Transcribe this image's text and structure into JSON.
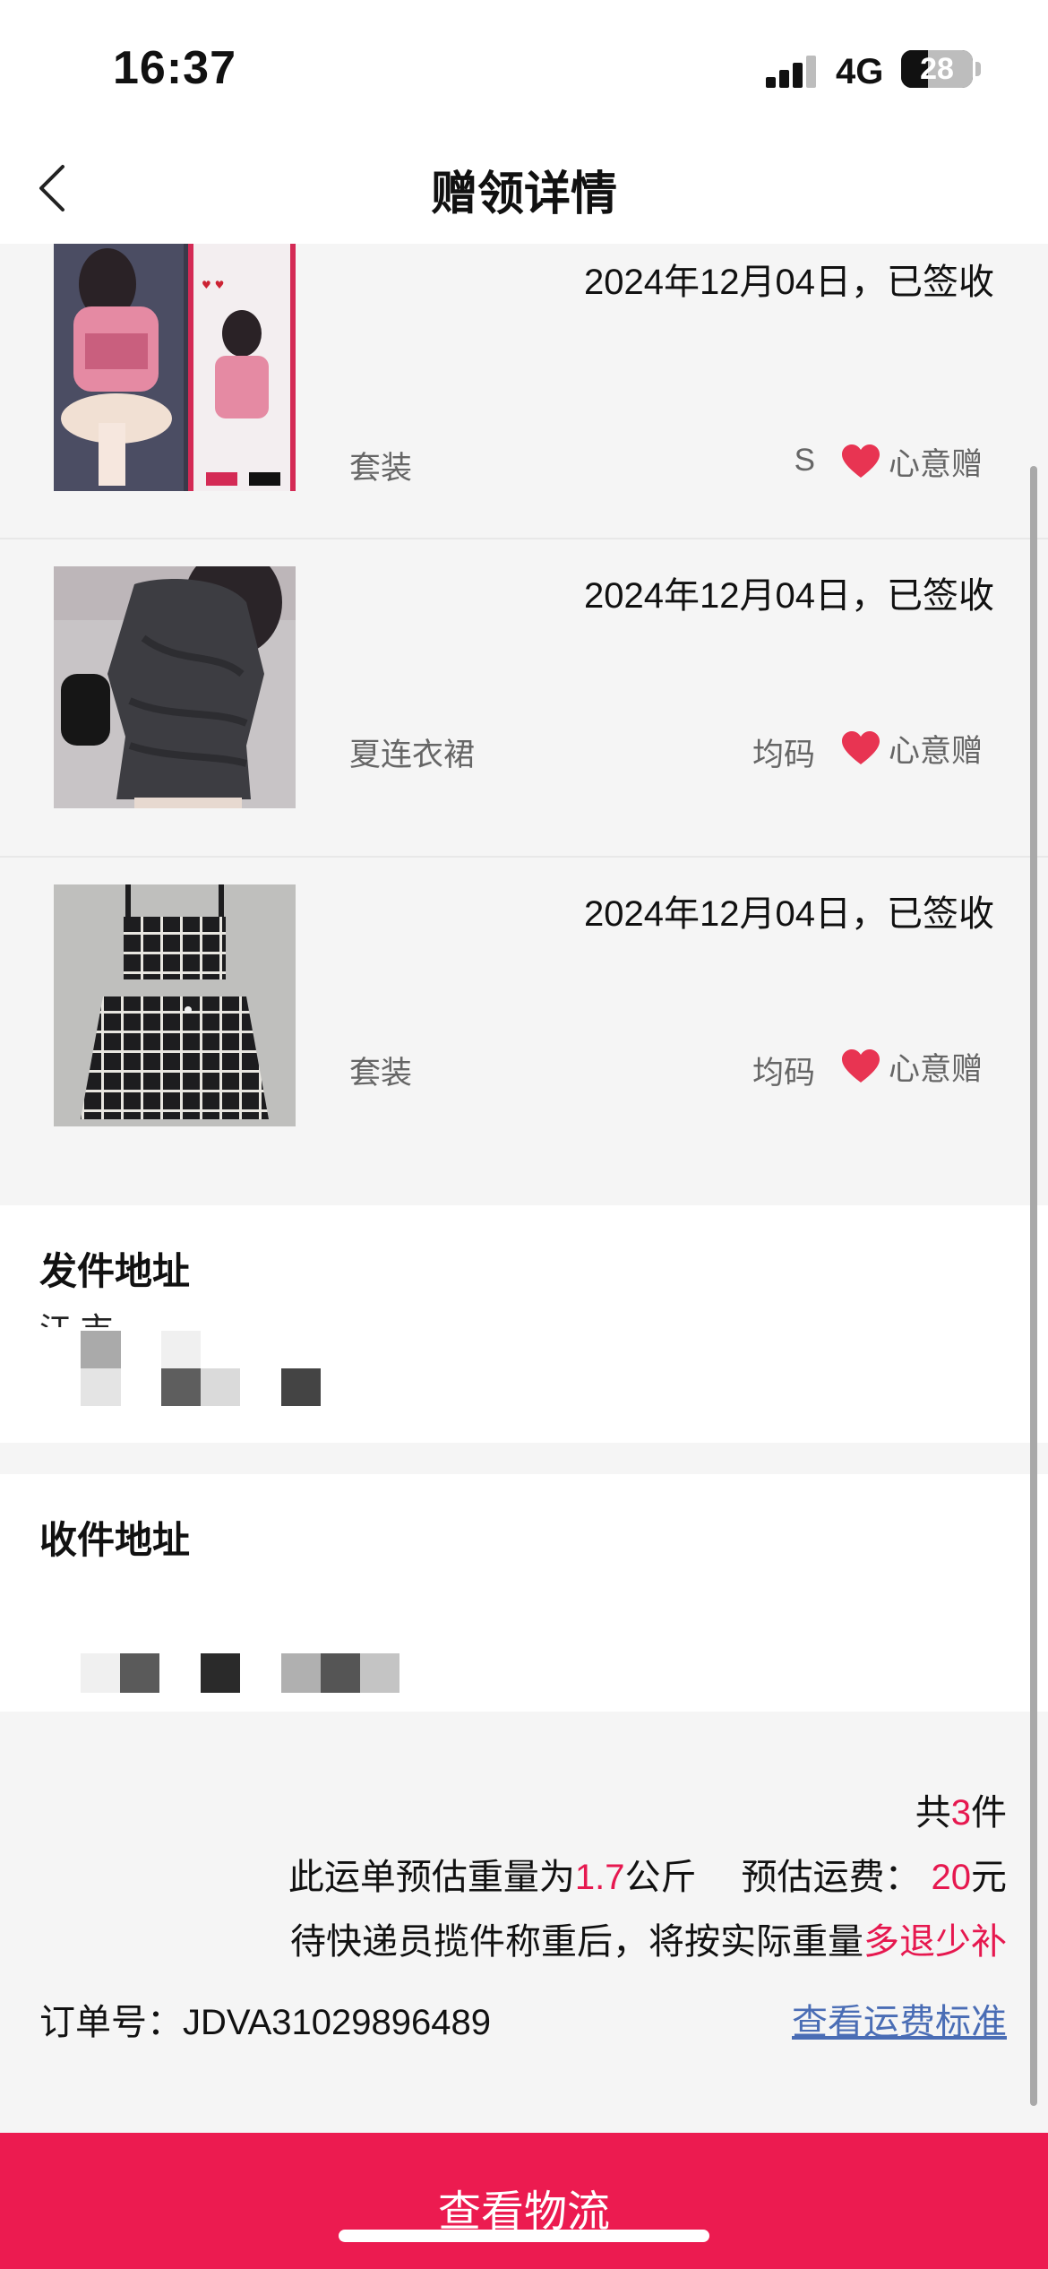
{
  "status_bar": {
    "time": "16:37",
    "network": "4G",
    "battery": "28"
  },
  "nav": {
    "title": "赠领详情"
  },
  "items": [
    {
      "date": "2024年12月04日，已签收",
      "name": "套装",
      "size": "S",
      "gift_label": "心意赠"
    },
    {
      "date": "2024年12月04日，已签收",
      "name": "夏连衣裙",
      "size": "均码",
      "gift_label": "心意赠"
    },
    {
      "date": "2024年12月04日，已签收",
      "name": "套装",
      "size": "均码",
      "gift_label": "心意赠"
    }
  ],
  "sender": {
    "title": "发件地址",
    "line": "江 市"
  },
  "receiver": {
    "title": "收件地址"
  },
  "summary": {
    "count_prefix": "共",
    "count": "3",
    "count_suffix": "件",
    "weight_prefix": "此运单预估重量为",
    "weight": "1.7",
    "weight_unit": "公斤",
    "fee_label": "预估运费：",
    "fee": "20",
    "fee_unit": "元",
    "note_prefix": "待快递员揽件称重后，将按实际重量",
    "note_highlight": "多退少补",
    "order_label": "订单号：",
    "order_no": "JDVA31029896489",
    "fee_standard_link": "查看运费标准"
  },
  "bottom_button": {
    "label": "查看物流"
  },
  "colors": {
    "accent": "#ec1b50",
    "link": "#4a6db5",
    "heart": "#e83452"
  }
}
